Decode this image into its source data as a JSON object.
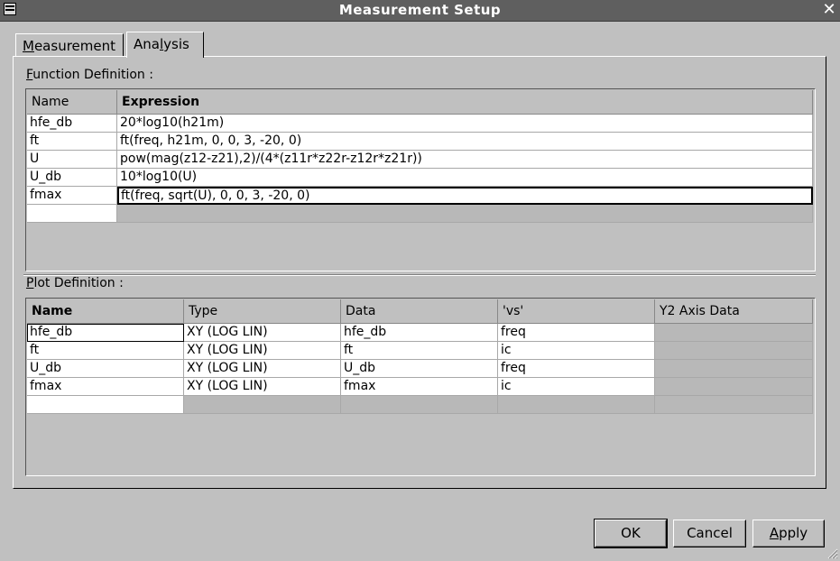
{
  "window": {
    "title": "Measurement Setup",
    "close_glyph": "✕"
  },
  "tabs": [
    {
      "label": "Measurement",
      "mnemonic": "M",
      "rest": "easurement",
      "active": false
    },
    {
      "label": "Analysis",
      "pre": "Ana",
      "mnemonic": "l",
      "rest": "ysis",
      "active": true
    }
  ],
  "function_section": {
    "label": "Function Definition :",
    "mnemonic": "F",
    "rest": "unction Definition :"
  },
  "function_table": {
    "headers": [
      "Name",
      "Expression"
    ],
    "rows": [
      {
        "name": "hfe_db",
        "expression": "20*log10(h21m)"
      },
      {
        "name": "ft",
        "expression": "ft(freq, h21m, 0, 0, 3, -20, 0)"
      },
      {
        "name": "U",
        "expression": "pow(mag(z12-z21),2)/(4*(z11r*z22r-z12r*z21r))"
      },
      {
        "name": "U_db",
        "expression": "10*log10(U)"
      },
      {
        "name": "fmax",
        "expression": "ft(freq, sqrt(U), 0, 0, 3, -20, 0)"
      }
    ]
  },
  "plot_section": {
    "label": "Plot Definition :",
    "mnemonic": "P",
    "rest": "lot Definition :"
  },
  "plot_table": {
    "headers": [
      "Name",
      "Type",
      "Data",
      "'vs'",
      "Y2 Axis Data"
    ],
    "rows": [
      {
        "name": "hfe_db",
        "type": "XY (LOG LIN)",
        "data": "hfe_db",
        "vs": "freq",
        "y2": ""
      },
      {
        "name": "ft",
        "type": "XY (LOG LIN)",
        "data": "ft",
        "vs": "ic",
        "y2": ""
      },
      {
        "name": "U_db",
        "type": "XY (LOG LIN)",
        "data": "U_db",
        "vs": "freq",
        "y2": ""
      },
      {
        "name": "fmax",
        "type": "XY (LOG LIN)",
        "data": "fmax",
        "vs": "ic",
        "y2": ""
      }
    ]
  },
  "buttons": {
    "ok": "OK",
    "cancel": "Cancel",
    "apply_mnemonic": "A",
    "apply_rest": "pply"
  }
}
